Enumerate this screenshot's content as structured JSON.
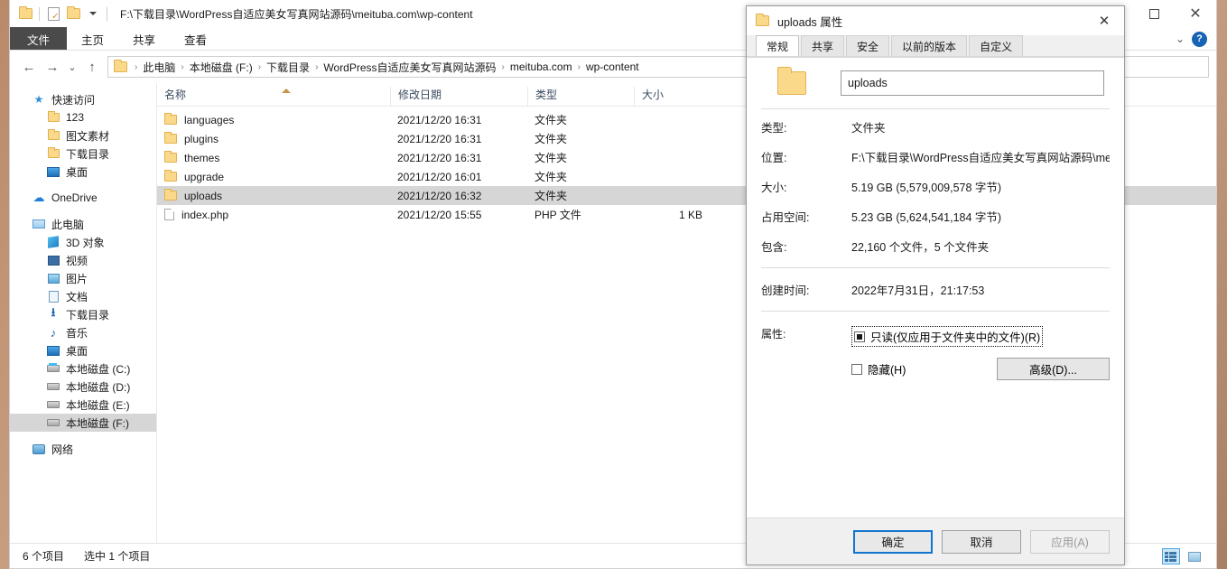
{
  "window": {
    "title_path": "F:\\下载目录\\WordPress自适应美女写真网站源码\\meituba.com\\wp-content",
    "quick_access": [
      {
        "name": "folder-icon",
        "label": "文件夹"
      },
      {
        "name": "properties-icon",
        "label": "属性"
      },
      {
        "name": "new-folder-icon",
        "label": "新建文件夹"
      },
      {
        "name": "customize-dropdown-icon",
        "label": "自定义快速访问工具栏"
      }
    ],
    "controls": {
      "maximize": "□",
      "close": "✕",
      "ribbon_collapse": "⌄",
      "help": "?"
    }
  },
  "ribbon": {
    "tabs": [
      {
        "label": "文件",
        "active": true
      },
      {
        "label": "主页",
        "active": false
      },
      {
        "label": "共享",
        "active": false
      },
      {
        "label": "查看",
        "active": false
      }
    ]
  },
  "addressbar": {
    "back": "←",
    "forward": "→",
    "recent": "⌄",
    "up": "↑",
    "breadcrumbs": [
      "此电脑",
      "本地磁盘 (F:)",
      "下载目录",
      "WordPress自适应美女写真网站源码",
      "meituba.com",
      "wp-content"
    ],
    "separator": "›",
    "search_placeholder": ""
  },
  "navpane": {
    "groups": [
      {
        "items": [
          {
            "label": "快速访问",
            "icon": "star-icon",
            "indent": 0,
            "selected": false
          },
          {
            "label": "123",
            "icon": "folder-icon",
            "indent": 1,
            "selected": false
          },
          {
            "label": "图文素材",
            "icon": "folder-icon",
            "indent": 1,
            "selected": false
          },
          {
            "label": "下载目录",
            "icon": "folder-icon",
            "indent": 1,
            "selected": false
          },
          {
            "label": "桌面",
            "icon": "desktop-icon",
            "indent": 1,
            "selected": false
          }
        ]
      },
      {
        "items": [
          {
            "label": "OneDrive",
            "icon": "cloud-icon",
            "indent": 0,
            "selected": false
          }
        ]
      },
      {
        "items": [
          {
            "label": "此电脑",
            "icon": "computer-icon",
            "indent": 0,
            "selected": false
          },
          {
            "label": "3D 对象",
            "icon": "cube-icon",
            "indent": 1,
            "selected": false
          },
          {
            "label": "视频",
            "icon": "video-icon",
            "indent": 1,
            "selected": false
          },
          {
            "label": "图片",
            "icon": "picture-icon",
            "indent": 1,
            "selected": false
          },
          {
            "label": "文档",
            "icon": "document-icon",
            "indent": 1,
            "selected": false
          },
          {
            "label": "下载目录",
            "icon": "download-icon",
            "indent": 1,
            "selected": false
          },
          {
            "label": "音乐",
            "icon": "music-icon",
            "indent": 1,
            "selected": false
          },
          {
            "label": "桌面",
            "icon": "desktop-icon",
            "indent": 1,
            "selected": false
          },
          {
            "label": "本地磁盘 (C:)",
            "icon": "system-drive-icon",
            "indent": 1,
            "selected": false
          },
          {
            "label": "本地磁盘 (D:)",
            "icon": "drive-icon",
            "indent": 1,
            "selected": false
          },
          {
            "label": "本地磁盘 (E:)",
            "icon": "drive-icon",
            "indent": 1,
            "selected": false
          },
          {
            "label": "本地磁盘 (F:)",
            "icon": "drive-icon",
            "indent": 1,
            "selected": true
          }
        ]
      },
      {
        "items": [
          {
            "label": "网络",
            "icon": "network-icon",
            "indent": 0,
            "selected": false
          }
        ]
      }
    ]
  },
  "filelist": {
    "columns": [
      {
        "label": "名称",
        "key": "name"
      },
      {
        "label": "修改日期",
        "key": "date"
      },
      {
        "label": "类型",
        "key": "type"
      },
      {
        "label": "大小",
        "key": "size"
      }
    ],
    "sort_column": "名称",
    "sort_direction": "asc",
    "rows": [
      {
        "name": "languages",
        "date": "2021/12/20 16:31",
        "type": "文件夹",
        "size": "",
        "icon": "folder-icon",
        "selected": false
      },
      {
        "name": "plugins",
        "date": "2021/12/20 16:31",
        "type": "文件夹",
        "size": "",
        "icon": "folder-icon",
        "selected": false
      },
      {
        "name": "themes",
        "date": "2021/12/20 16:31",
        "type": "文件夹",
        "size": "",
        "icon": "folder-icon",
        "selected": false
      },
      {
        "name": "upgrade",
        "date": "2021/12/20 16:01",
        "type": "文件夹",
        "size": "",
        "icon": "folder-icon",
        "selected": false
      },
      {
        "name": "uploads",
        "date": "2021/12/20 16:32",
        "type": "文件夹",
        "size": "",
        "icon": "folder-icon",
        "selected": true
      },
      {
        "name": "index.php",
        "date": "2021/12/20 15:55",
        "type": "PHP 文件",
        "size": "1 KB",
        "icon": "php-file-icon",
        "selected": false
      }
    ]
  },
  "statusbar": {
    "item_count": "6 个项目",
    "selection": "选中 1 个项目",
    "view_buttons": [
      {
        "name": "details-view-button",
        "active": true
      },
      {
        "name": "large-icons-view-button",
        "active": false
      }
    ]
  },
  "dialog": {
    "title": "uploads 属性",
    "close": "✕",
    "tabs": [
      {
        "label": "常规",
        "active": true
      },
      {
        "label": "共享",
        "active": false
      },
      {
        "label": "安全",
        "active": false
      },
      {
        "label": "以前的版本",
        "active": false
      },
      {
        "label": "自定义",
        "active": false
      }
    ],
    "name_value": "uploads",
    "properties": [
      {
        "label": "类型:",
        "value": "文件夹"
      },
      {
        "label": "位置:",
        "value": "F:\\下载目录\\WordPress自适应美女写真网站源码\\me"
      },
      {
        "label": "大小:",
        "value": "5.19 GB (5,579,009,578 字节)"
      },
      {
        "label": "占用空间:",
        "value": "5.23 GB (5,624,541,184 字节)"
      },
      {
        "label": "包含:",
        "value": "22,160 个文件，5 个文件夹"
      }
    ],
    "created": {
      "label": "创建时间:",
      "value": "2022年7月31日，21:17:53"
    },
    "attributes": {
      "label": "属性:",
      "readonly": {
        "text": "只读(仅应用于文件夹中的文件)(R)",
        "state": "mixed",
        "focused": true
      },
      "hidden": {
        "text": "隐藏(H)",
        "state": "unchecked",
        "focused": false
      },
      "advanced_button": "高级(D)..."
    },
    "buttons": [
      {
        "label": "确定",
        "style": "default"
      },
      {
        "label": "取消",
        "style": "normal"
      },
      {
        "label": "应用(A)",
        "style": "disabled"
      }
    ]
  },
  "colors": {
    "accent": "#1175cd",
    "selection": "#d6d6d6",
    "file_tab_bg": "#4a4a4a",
    "folder_yellow": "#fbd98b",
    "sort_caret": "#c8934d"
  }
}
